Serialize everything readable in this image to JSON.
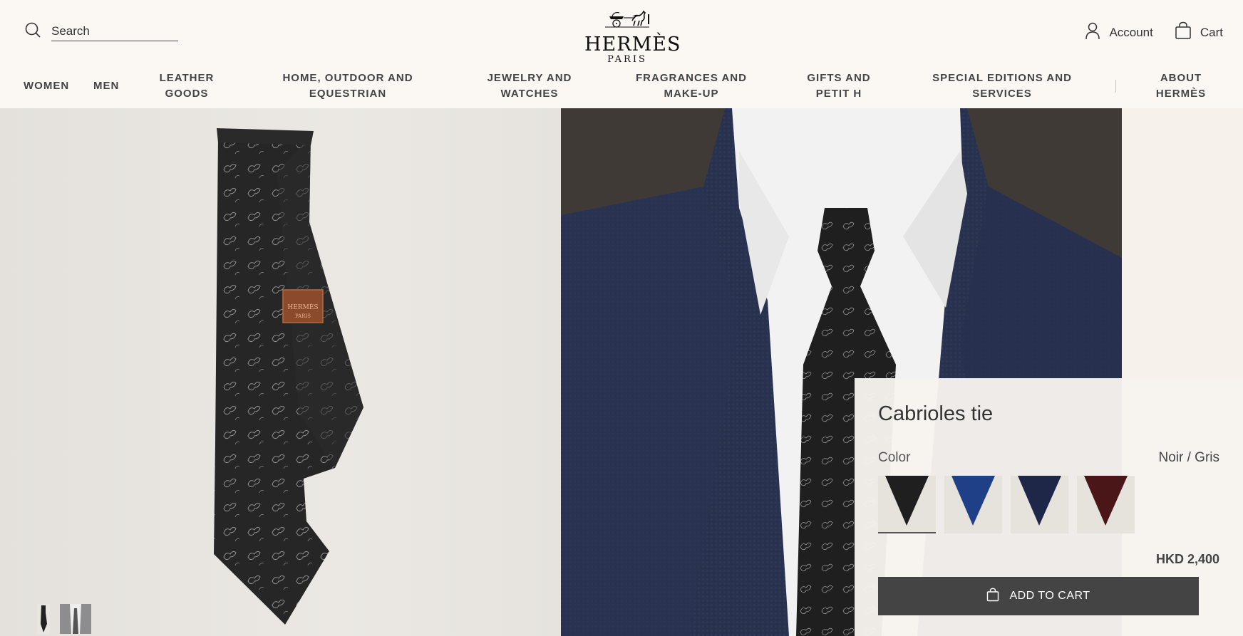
{
  "header": {
    "search_placeholder": "Search",
    "logo_word": "HERMÈS",
    "logo_sub": "PARIS",
    "account_label": "Account",
    "cart_label": "Cart"
  },
  "nav": {
    "women": "WOMEN",
    "men": "MEN",
    "leather": [
      "LEATHER",
      "GOODS"
    ],
    "home": [
      "HOME, OUTDOOR AND",
      "EQUESTRIAN"
    ],
    "jewelry": [
      "JEWELRY AND",
      "WATCHES"
    ],
    "fragrances": [
      "FRAGRANCES AND",
      "MAKE-UP"
    ],
    "gifts": [
      "GIFTS AND",
      "PETIT H"
    ],
    "special": [
      "SPECIAL EDITIONS AND",
      "SERVICES"
    ],
    "about": [
      "ABOUT",
      "HERMÈS"
    ]
  },
  "gallery": {
    "tie_label_line1": "HERMÈS",
    "tie_label_line2": "PARIS"
  },
  "product": {
    "title": "Cabrioles tie",
    "color_label": "Color",
    "color_value": "Noir / Gris",
    "swatch_colors": [
      "#1f1f20",
      "#1f3f86",
      "#1e2748",
      "#4a1618"
    ],
    "price": "HKD 2,400",
    "add_to_cart": "ADD TO CART"
  },
  "colors": {
    "header_bg": "#fbf7f3",
    "button_bg": "#444444",
    "panel_bg": "#f7f3ee"
  }
}
